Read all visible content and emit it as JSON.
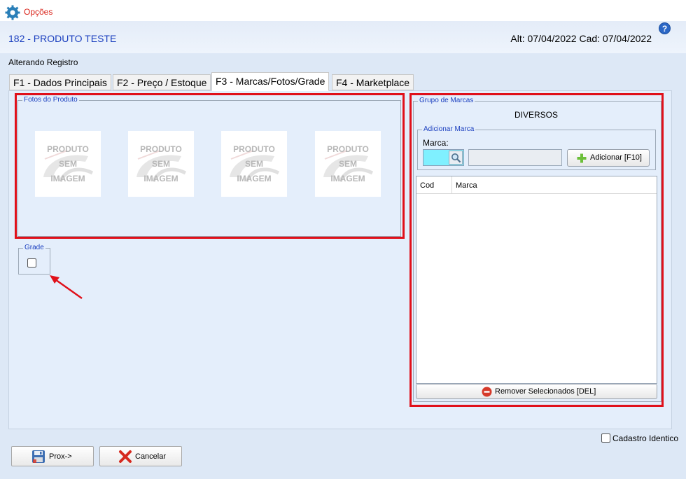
{
  "window": {
    "title": "Opções"
  },
  "header": {
    "product_title": "182 - PRODUTO TESTE",
    "dates": "Alt: 07/04/2022 Cad: 07/04/2022",
    "help": "?"
  },
  "status": "Alterando Registro",
  "tabs": [
    {
      "label": "F1 - Dados Principais",
      "active": false
    },
    {
      "label": "F2 - Preço / Estoque",
      "active": false
    },
    {
      "label": "F3 - Marcas/Fotos/Grade",
      "active": true
    },
    {
      "label": "F4 - Marketplace",
      "active": false
    }
  ],
  "photos": {
    "legend": "Fotos do Produto",
    "placeholder_lines": [
      "PRODUTO",
      "SEM",
      "IMAGEM"
    ],
    "count": 4
  },
  "grade": {
    "legend": "Grade",
    "checked": false
  },
  "brands": {
    "legend": "Grupo de Marcas",
    "group_name": "DIVERSOS",
    "add_legend": "Adicionar Marca",
    "marca_label": "Marca:",
    "add_button": "Adicionar [F10]",
    "columns": [
      "Cod",
      "Marca"
    ],
    "rows": [],
    "remove_button": "Remover Selecionados [DEL]"
  },
  "footer": {
    "cadastro_identico": "Cadastro Identico",
    "next_button": "Prox->",
    "cancel_button": "Cancelar"
  },
  "colors": {
    "title_red": "#d9241a",
    "product_blue": "#1b3fbf",
    "highlight_red": "#e0101a",
    "marca_input_cyan": "#7ff0ff"
  },
  "icons": {
    "app": "gear-icon",
    "help": "help-icon",
    "search": "magnifier-icon",
    "add": "plus-icon",
    "remove": "minus-circle-icon",
    "next": "floppy-disk-icon",
    "cancel": "red-x-icon"
  }
}
